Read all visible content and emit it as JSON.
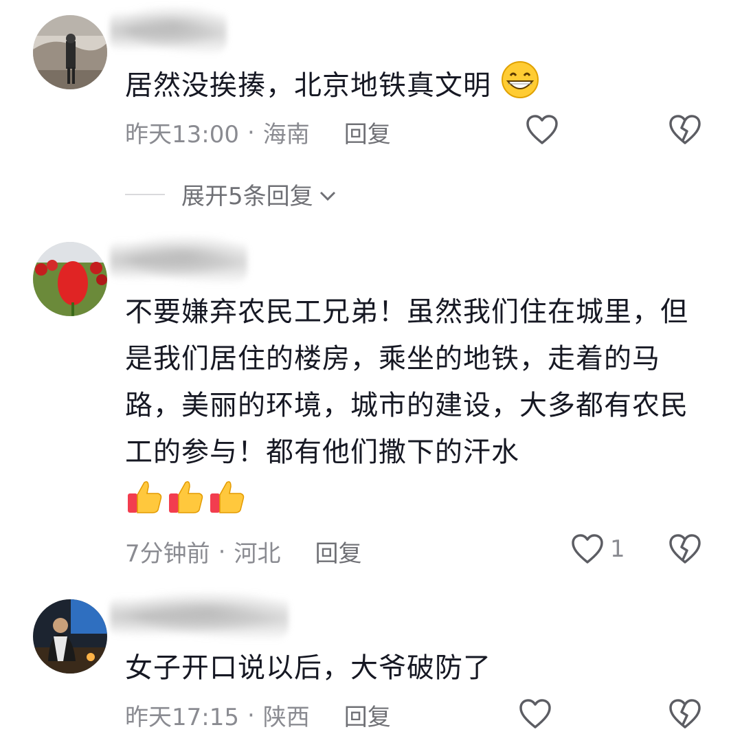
{
  "comments": [
    {
      "text": "居然没挨揍，北京地铁真文明",
      "emoji": "grin-emoji",
      "time": "昨天13:00",
      "location": "海南",
      "reply_label": "回复",
      "expand_label": "展开5条回复"
    },
    {
      "text": "不要嫌弃农民工兄弟！虽然我们住在城里，但是我们居住的楼房，乘坐的地铁，走着的马路，美丽的环境，城市的建设，大多都有农民工的参与！都有他们撒下的汗水",
      "emoji": "thumbs-up-emoji",
      "time": "7分钟前",
      "location": "河北",
      "reply_label": "回复",
      "like_count": "1"
    },
    {
      "text": "女子开口说以后，大爷破防了",
      "time": "昨天17:15",
      "location": "陕西",
      "reply_label": "回复"
    }
  ],
  "separator": "·",
  "colors": {
    "text": "#161823",
    "meta": "#8a8b91",
    "icon": "#5c5d63"
  }
}
